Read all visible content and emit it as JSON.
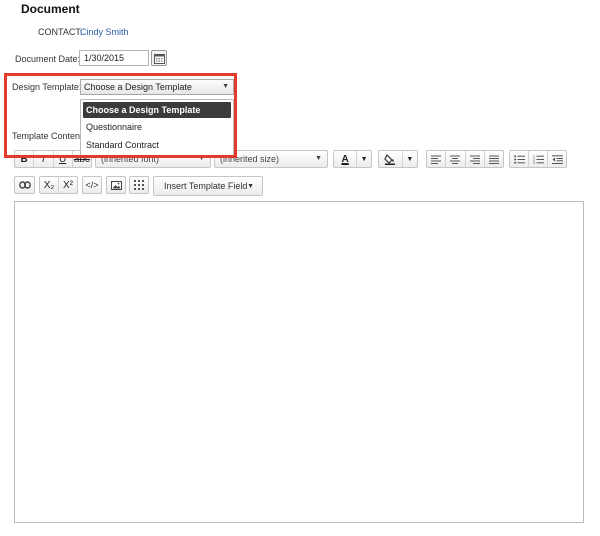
{
  "page": {
    "title": "Document"
  },
  "contact": {
    "label": "CONTACT:",
    "name": "Cindy Smith"
  },
  "document_date": {
    "label": "Document Date:",
    "value": "1/30/2015"
  },
  "design_template": {
    "label": "Design Template:",
    "selected": "Choose a Design Template",
    "options": [
      "Choose a Design Template",
      "Questionnaire",
      "Standard Contract"
    ]
  },
  "template_content": {
    "label": "Template Content:"
  },
  "toolbar": {
    "bold": "B",
    "italic": "I",
    "underline": "U",
    "strike": "abc",
    "font_family": "(inherited font)",
    "font_size": "(inherited size)",
    "font_color": "A",
    "subscript": "X₂",
    "superscript": "X²",
    "html": "</>",
    "insert_template_field": "Insert Template Field"
  },
  "colors": {
    "highlight": "#e33a2c",
    "link": "#2b5ea8"
  }
}
